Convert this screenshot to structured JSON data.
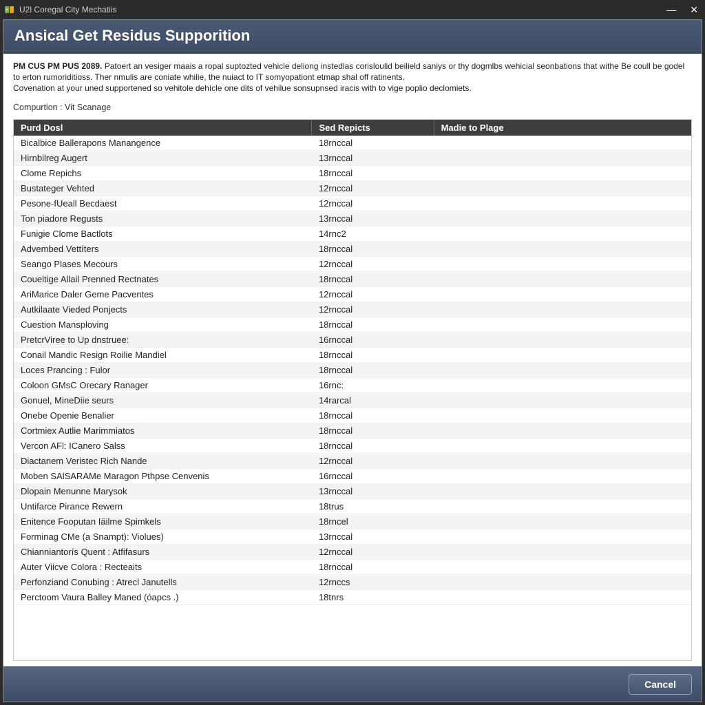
{
  "window": {
    "title": "U2l Coregal City Mechatiis"
  },
  "header": {
    "title": "Ansical Get Residus Supporition"
  },
  "intro": {
    "bold_lead": "PM CUS PM PUS 2089.",
    "line1_rest": " Patoert an vesiger maais a ropal suptozted vehicle deliong instedlas corisloulid beilield saniys or thy dogmlbs wehicial seonbations that withe Be coull be godel to erton rumoriditioss. Ther nmulis are coniate whilie, the nuiact to IT somyopationt etmap shal off ratinents.",
    "line2": "Covenation at your uned supportened so vehitole dehícle one dits of vehilue sonsupnsed iracis with to vige poplio declomiets."
  },
  "comp": {
    "label": "Compurtion :",
    "value": "Vit Scanage"
  },
  "table": {
    "headers": {
      "c1": "Purd Dosl",
      "c2": "Sed Repicts",
      "c3": "Madie to Plage"
    },
    "rows": [
      {
        "c1": "Bicalbice Ballerapons Manangence",
        "c2": "18rnccal",
        "c3": ""
      },
      {
        "c1": "Hirnbilreg Augert",
        "c2": "13rnccal",
        "c3": ""
      },
      {
        "c1": "Clome Repichs",
        "c2": "18rnccal",
        "c3": ""
      },
      {
        "c1": "Bustateger Vehted",
        "c2": "12rnccal",
        "c3": ""
      },
      {
        "c1": "Pesone-fUeall Becdaest",
        "c2": "12rnccal",
        "c3": ""
      },
      {
        "c1": "Ton piadore Regusts",
        "c2": "13rnccal",
        "c3": ""
      },
      {
        "c1": "Funigie Clome Bactlots",
        "c2": "14rnc2",
        "c3": ""
      },
      {
        "c1": "Advembed Vettíters",
        "c2": "18rnccal",
        "c3": ""
      },
      {
        "c1": "Seango Plases Mecours",
        "c2": "12rnccal",
        "c3": ""
      },
      {
        "c1": "Coueltige Allail Prenned Rectnates",
        "c2": "18rnccal",
        "c3": ""
      },
      {
        "c1": "AriMarice Daler Geme Pacventes",
        "c2": "12rnccal",
        "c3": ""
      },
      {
        "c1": "Autkilaate Vieded Ponjects",
        "c2": "12rnccal",
        "c3": ""
      },
      {
        "c1": "Cuestion Mansploving",
        "c2": "18rnccal",
        "c3": ""
      },
      {
        "c1": "PretcrViree to Up dnstruee:",
        "c2": "16rnccal",
        "c3": ""
      },
      {
        "c1": "Conail Mandic Resign Roilie Mandiel",
        "c2": "18rnccal",
        "c3": ""
      },
      {
        "c1": "Loces Prancing : Fulor",
        "c2": "18rnccal",
        "c3": ""
      },
      {
        "c1": "Coloon GMsC Orecary Ranager",
        "c2": "16rnc:",
        "c3": ""
      },
      {
        "c1": "Gonuel, MineDiie seurs",
        "c2": "14rarcal",
        "c3": ""
      },
      {
        "c1": "Onebe Openie Benalier",
        "c2": "18rnccal",
        "c3": ""
      },
      {
        "c1": "Cortmiex Autlie Marimmiatos",
        "c2": "18rnccal",
        "c3": ""
      },
      {
        "c1": "Vercon AFl: ICanero Salss",
        "c2": "18rnccal",
        "c3": ""
      },
      {
        "c1": "Diactanem Veristec Rich Nande",
        "c2": "12rnccal",
        "c3": ""
      },
      {
        "c1": "Moben SAlSARAMe Maragon Pthpse Cenvenis",
        "c2": "16rnccal",
        "c3": ""
      },
      {
        "c1": "Dlopain Menunne Marysok",
        "c2": "13rnccal",
        "c3": ""
      },
      {
        "c1": "Untifarce Pirance Rewern",
        "c2": "18trus",
        "c3": ""
      },
      {
        "c1": "Enitence Fooputan Iäilme Spimkels",
        "c2": "18rncel",
        "c3": ""
      },
      {
        "c1": "Forminag CMe (a Snampt): Violues)",
        "c2": "13rnccal",
        "c3": ""
      },
      {
        "c1": "Chianniantorís Quent : Atfifasurs",
        "c2": "12rnccal",
        "c3": ""
      },
      {
        "c1": "Auter Viicve Colora : Recteaits",
        "c2": "18rnccal",
        "c3": ""
      },
      {
        "c1": "Perfonziand Conubing : Atrecl Janutells",
        "c2": "12rnccs",
        "c3": ""
      },
      {
        "c1": "Perctoom Vaura Balley Maned (óapcs .)",
        "c2": "18tnrs",
        "c3": ""
      }
    ]
  },
  "footer": {
    "cancel_label": "Cancel"
  }
}
